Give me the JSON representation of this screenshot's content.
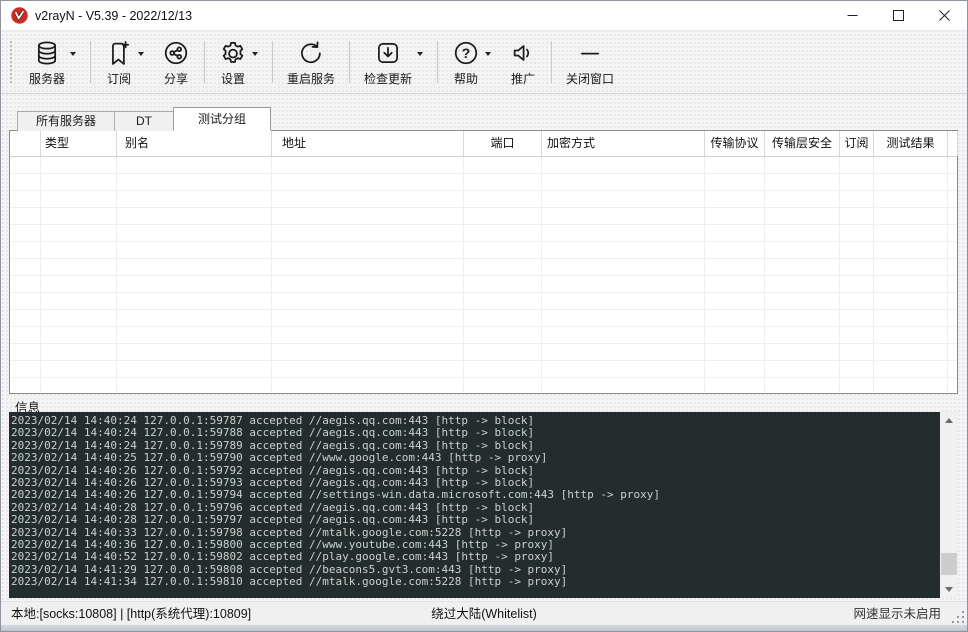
{
  "window": {
    "title": "v2rayN - V5.39 - 2022/12/13"
  },
  "titlebar": {
    "buttons": [
      {
        "name": "minimize",
        "icon": "minimize-icon"
      },
      {
        "name": "maximize",
        "icon": "maximize-icon"
      },
      {
        "name": "close",
        "icon": "close-icon"
      }
    ]
  },
  "toolbar": {
    "items": [
      {
        "label": "服务器",
        "icon": "database-icon",
        "dropdown": true,
        "sep_after": true
      },
      {
        "label": "订阅",
        "icon": "bookmark-add-icon",
        "dropdown": true,
        "sep_after": false
      },
      {
        "label": "分享",
        "icon": "share-icon",
        "dropdown": false,
        "sep_after": true
      },
      {
        "label": "设置",
        "icon": "gear-icon",
        "dropdown": true,
        "sep_after": true
      },
      {
        "label": "重启服务",
        "icon": "restart-icon",
        "dropdown": false,
        "sep_after": true
      },
      {
        "label": "检查更新",
        "icon": "update-download-icon",
        "dropdown": true,
        "sep_after": true
      },
      {
        "label": "帮助",
        "icon": "help-icon",
        "dropdown": true,
        "sep_after": false
      },
      {
        "label": "推广",
        "icon": "speaker-icon",
        "dropdown": false,
        "sep_after": true
      },
      {
        "label": "关闭窗口",
        "icon": "close-window-icon",
        "dropdown": false,
        "sep_after": false
      }
    ]
  },
  "tabs": [
    {
      "label": "所有服务器",
      "active": false
    },
    {
      "label": "DT",
      "active": false
    },
    {
      "label": "测试分组",
      "active": true
    }
  ],
  "table": {
    "columns": [
      "类型",
      "别名",
      "地址",
      "端口",
      "加密方式",
      "传输协议",
      "传输层安全",
      "订阅",
      "测试结果"
    ],
    "rows": []
  },
  "info": {
    "title": "信息",
    "log_lines": [
      "2023/02/14 14:40:24 127.0.0.1:59787 accepted //aegis.qq.com:443 [http -> block]",
      "2023/02/14 14:40:24 127.0.0.1:59788 accepted //aegis.qq.com:443 [http -> block]",
      "2023/02/14 14:40:24 127.0.0.1:59789 accepted //aegis.qq.com:443 [http -> block]",
      "2023/02/14 14:40:25 127.0.0.1:59790 accepted //www.google.com:443 [http -> proxy]",
      "2023/02/14 14:40:26 127.0.0.1:59792 accepted //aegis.qq.com:443 [http -> block]",
      "2023/02/14 14:40:26 127.0.0.1:59793 accepted //aegis.qq.com:443 [http -> block]",
      "2023/02/14 14:40:26 127.0.0.1:59794 accepted //settings-win.data.microsoft.com:443 [http -> proxy]",
      "2023/02/14 14:40:28 127.0.0.1:59796 accepted //aegis.qq.com:443 [http -> block]",
      "2023/02/14 14:40:28 127.0.0.1:59797 accepted //aegis.qq.com:443 [http -> block]",
      "2023/02/14 14:40:33 127.0.0.1:59798 accepted //mtalk.google.com:5228 [http -> proxy]",
      "2023/02/14 14:40:36 127.0.0.1:59800 accepted //www.youtube.com:443 [http -> proxy]",
      "2023/02/14 14:40:52 127.0.0.1:59802 accepted //play.google.com:443 [http -> proxy]",
      "2023/02/14 14:41:29 127.0.0.1:59808 accepted //beacons5.gvt3.com:443 [http -> proxy]",
      "2023/02/14 14:41:34 127.0.0.1:59810 accepted //mtalk.google.com:5228 [http -> proxy]"
    ]
  },
  "statusbar": {
    "local": "本地:[socks:10808] | [http(系统代理):10809]",
    "route": "绕过大陆(Whitelist)",
    "speed": "网速显示未启用"
  },
  "colors": {
    "brand_red": "#cf2b23",
    "log_bg": "#232d2d",
    "log_text": "#ccd1cc"
  }
}
